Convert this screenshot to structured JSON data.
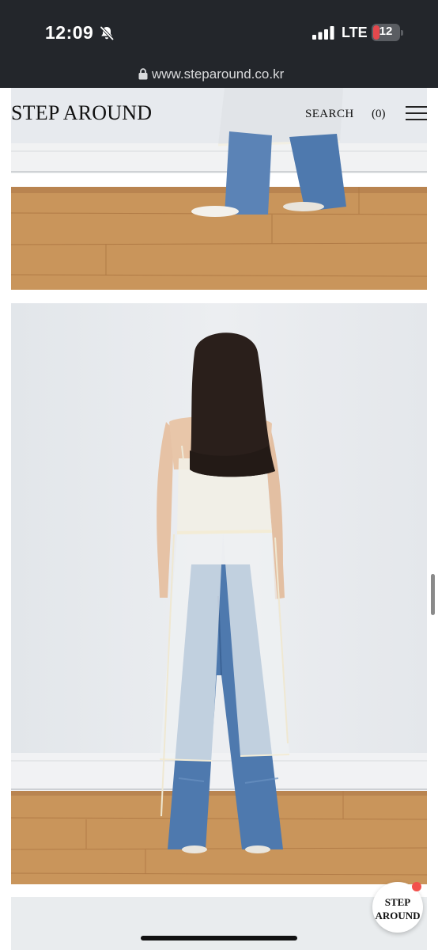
{
  "status_bar": {
    "time": "12:09",
    "network": "LTE",
    "battery": "12",
    "icons": [
      "bell-slash-icon",
      "signal-bars-icon",
      "battery-icon"
    ]
  },
  "browser": {
    "url": "www.steparound.co.kr",
    "lock_icon": "lock-icon"
  },
  "header": {
    "brand": "STEP AROUND",
    "search_label": "SEARCH",
    "cart_label": "(0)",
    "menu_icon": "hamburger-menu-icon"
  },
  "chat_badge": {
    "line1": "STEP",
    "line2": "AROUND"
  },
  "colors": {
    "topbar": "#23262b",
    "battery_low": "#e5484d",
    "badge_dot": "#f2514c",
    "wall": "#e8ebee",
    "floor": "#c9955b",
    "denim": "#4e79ae",
    "organza": "#f1efe6"
  }
}
